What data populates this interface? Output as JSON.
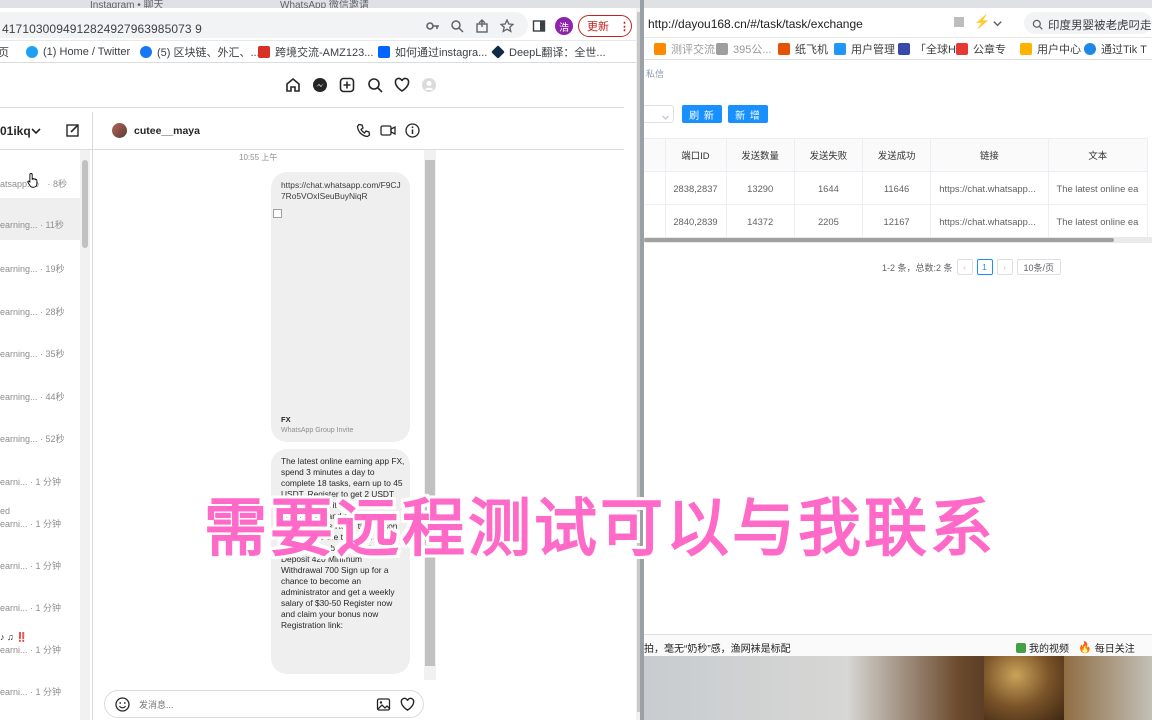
{
  "left_browser": {
    "tabs": [
      "Instagram • 聊天",
      "WhatsApp 微信邀请"
    ],
    "url": "4171030094912824927963985073 9",
    "update_button": "更新",
    "avatar_letter": "浩",
    "bookmarks": [
      {
        "label": "页",
        "color": "#4285f4"
      },
      {
        "label": "(1) Home / Twitter",
        "color": "#1da1f2"
      },
      {
        "label": "(5) 区块链、外汇、...",
        "color": "#1877f2"
      },
      {
        "label": "跨境交流-AMZ123...",
        "color": "#d93025"
      },
      {
        "label": "如何通过instagra...",
        "color": "#0066ff"
      },
      {
        "label": "DeepL翻译：全世...",
        "color": "#0f2b46"
      }
    ]
  },
  "instagram": {
    "account_name": "01ikq",
    "chat_user": "cutee__maya",
    "conversations": [
      {
        "preview": "atsapp.co",
        "time": "· 8秒",
        "active": false
      },
      {
        "preview": "earning...",
        "time": "· 11秒",
        "active": true
      },
      {
        "preview": "earning...",
        "time": "· 19秒",
        "active": false
      },
      {
        "preview": "earning...",
        "time": "· 28秒",
        "active": false
      },
      {
        "preview": "earning...",
        "time": "· 35秒",
        "active": false
      },
      {
        "preview": "earning...",
        "time": "· 44秒",
        "active": false
      },
      {
        "preview": "earning...",
        "time": "· 52秒",
        "active": false
      },
      {
        "preview": "earni...",
        "time": "· 1 分钟",
        "active": false
      },
      {
        "preview": "earni...",
        "time": "· 1 分钟",
        "active": false
      },
      {
        "preview": "earni...",
        "time": "· 1 分钟",
        "active": false
      },
      {
        "preview": "earni...",
        "time": "· 1 分钟",
        "active": false
      },
      {
        "preview": "earni...",
        "time": "· 1 分钟",
        "active": false
      },
      {
        "preview": "earni...",
        "time": "· 1 分钟",
        "active": false
      }
    ],
    "conv_extra_labels": [
      "ed",
      "♪ ♫ ‼️"
    ],
    "time_label": "10:55 上午",
    "link_message": "https://chat.whatsapp.com/F9CJ7Ro5VOxISeuBuyNiqR",
    "link_title": "FX",
    "link_subtitle": "WhatsApp Group Invite",
    "text_message": "The latest online earning app FX, spend 3 minutes a day to complete 18 tasks, earn up to 45 USDT. Register to get 2 USDT every day. Invite friends to get commission and administrator referral bonus Refer the person to complete the task and get up to 13% team bonus Minimum Deposit 420 Minimum Withdrawal 700 Sign up for a chance to become an administrator and get a weekly salary of $30-50 Register now and claim your bonus now Registration link:",
    "input_placeholder": "发消息..."
  },
  "right_browser": {
    "url": "http://dayou168.cn/#/task/task/exchange",
    "search_text": "印度男婴被老虎叼走",
    "bookmarks": [
      "测评交流",
      "395公... ",
      "纸飞机",
      "用户管理",
      "「全球H",
      "公章专",
      "用户中心",
      "通过Tik T"
    ],
    "breadcrumb": "私信",
    "buttons": {
      "refresh": "刷 新",
      "add": "新 增"
    },
    "table": {
      "headers": [
        "端口ID",
        "发送数量",
        "发送失败",
        "发送成功",
        "链接",
        "文本"
      ],
      "rows": [
        [
          "2838,2837",
          "13290",
          "1644",
          "11646",
          "https://chat.whatsapp...",
          "The latest online ea"
        ],
        [
          "2840,2839",
          "14372",
          "2205",
          "12167",
          "https://chat.whatsapp...",
          "The latest online ea"
        ]
      ]
    },
    "pagination": {
      "summary": "1-2 条，总数:2 条",
      "current_page": "1",
      "page_size": "10条/页"
    },
    "bottom_bar": {
      "left_text": "拍，毫无“奶秒”感，渔网袜是标配",
      "links": [
        "我的视频",
        "每日关注"
      ]
    }
  },
  "overlay_caption": "需要远程测试可以与我联系",
  "colors": {
    "primary": "#1890ff",
    "caption": "#ff69c7",
    "update": "#c5221f"
  }
}
